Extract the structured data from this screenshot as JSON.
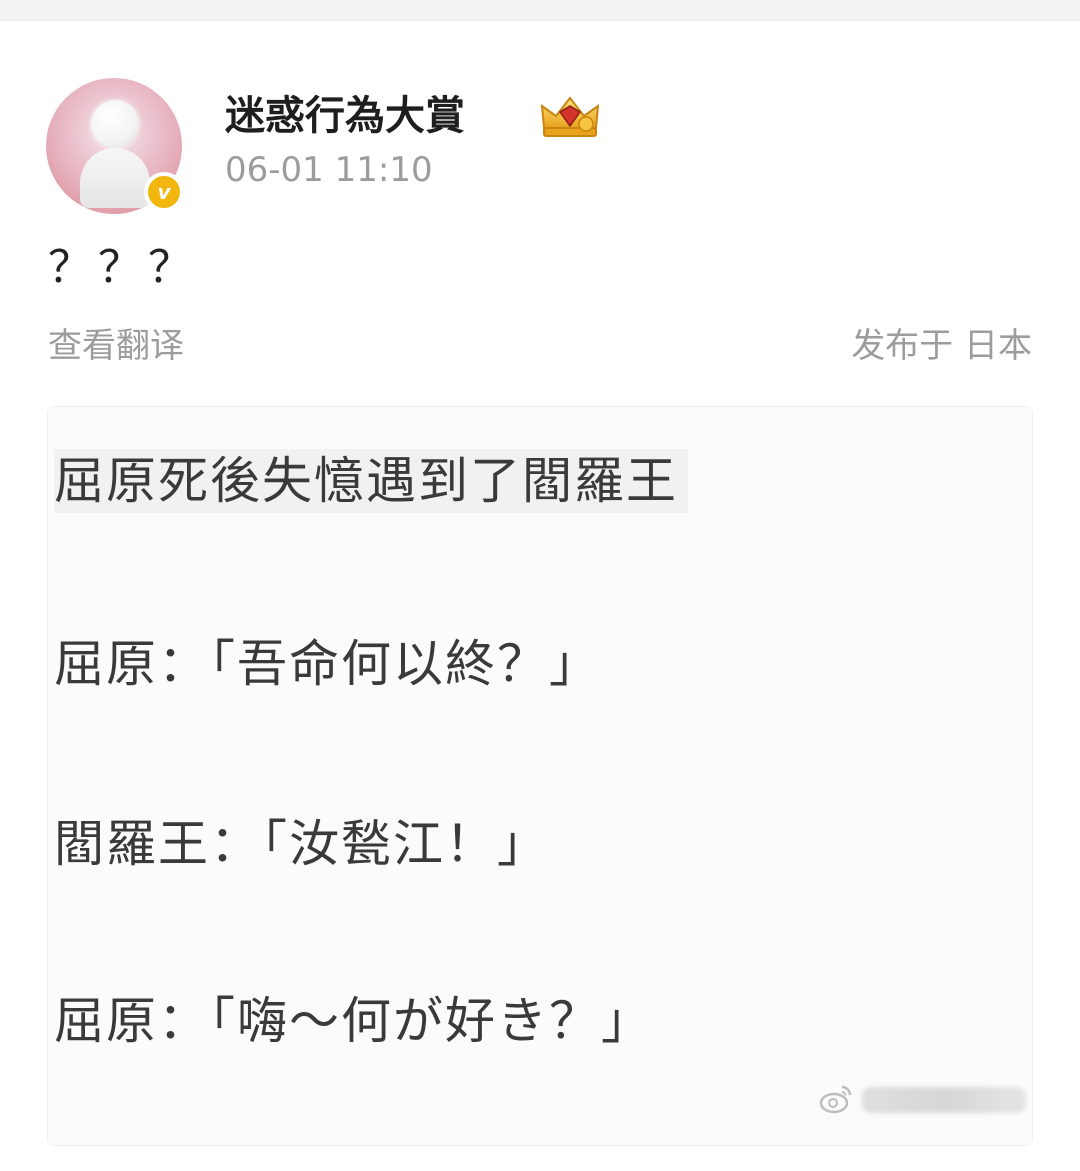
{
  "post": {
    "username": "迷惑行為大賞",
    "timestamp": "06-01 11:10",
    "text": "？？？",
    "translate_label": "查看翻译",
    "location_label": "发布于 日本"
  },
  "image": {
    "lines": [
      "屈原死後失憶遇到了閻羅王",
      "屈原：「吾命何以終？」",
      "閻羅王：「汝甃江！」",
      "屈原：「嗨～何が好き？」"
    ]
  },
  "colors": {
    "verified_badge": "#f2b60f",
    "meta_text": "#9c9c9c"
  },
  "icons": {
    "verified": "verified-v-icon",
    "crown": "crown-icon",
    "watermark": "weibo-logo-icon"
  }
}
